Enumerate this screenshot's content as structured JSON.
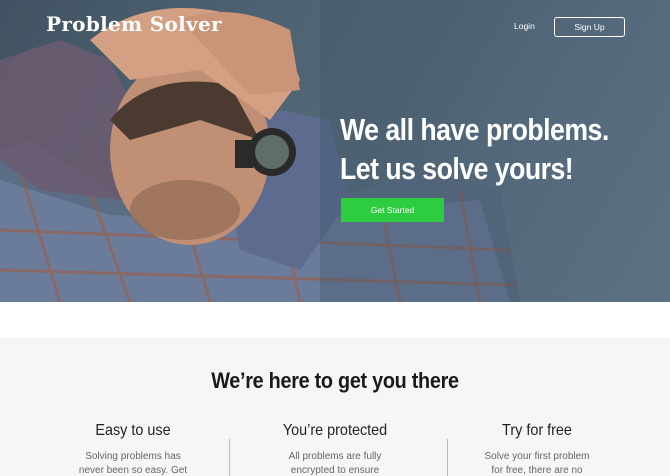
{
  "nav": {
    "brand": "Problem Solver",
    "login_label": "Login",
    "signup_label": "Sign Up"
  },
  "hero": {
    "headline_line1": "We all have problems.",
    "headline_line2": "Let us solve yours!",
    "cta_label": "Get Started"
  },
  "features": {
    "title": "We’re here to get you there",
    "items": [
      {
        "title": "Easy to use",
        "text": "Solving problems  has never been so easy. Get"
      },
      {
        "title": "You’re protected",
        "text": "All problems are fully encrypted to ensure"
      },
      {
        "title": "Try for free",
        "text": "Solve your first problem for free, there are no hidden"
      }
    ]
  },
  "colors": {
    "cta": "#2ecc40",
    "features_bg": "#f6f6f6",
    "text_light": "#ffffff"
  }
}
